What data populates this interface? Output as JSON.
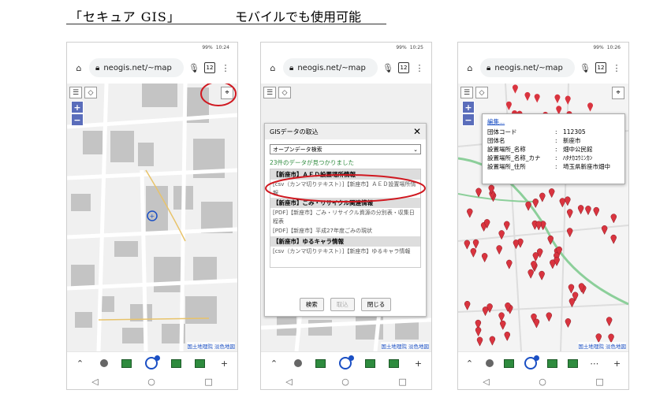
{
  "titles": {
    "left": "「セキュア GIS」",
    "right": "モバイルでも使用可能"
  },
  "phones": [
    {
      "time": "10:24",
      "battery": "99%",
      "url": "neogis.net/~map",
      "tab_count": "12"
    },
    {
      "time": "10:25",
      "battery": "99%",
      "url": "neogis.net/~map",
      "tab_count": "12"
    },
    {
      "time": "10:26",
      "battery": "99%",
      "url": "neogis.net/~map",
      "tab_count": "12"
    }
  ],
  "map": {
    "attribution": "国土地理院 淡色地図"
  },
  "dialog": {
    "title": "GISデータの取込",
    "close": "✕",
    "select_value": "オープンデータ検索",
    "found_text": "23件のデータが見つかりました",
    "items": [
      {
        "head": "【新座市】ＡＥＤ設置場所情報",
        "lines": [
          "[csv（カンマ切りテキスト）]【新座市】ＡＥＤ設置場所情報"
        ]
      },
      {
        "head": "【新座市】ごみ・リサイクル関連情報",
        "lines": [
          "[PDF]【新座市】ごみ・リサイクル資源の分別表・収集日程表",
          "[PDF]【新座市】平成27年度ごみの現状"
        ]
      },
      {
        "head": "【新座市】ゆるキャラ情報",
        "lines": [
          "[csv（カンマ切りテキスト）]【新座市】ゆるキャラ情報"
        ]
      }
    ],
    "buttons": {
      "search": "検索",
      "import": "取込",
      "close": "閉じる"
    }
  },
  "popup": {
    "edit": "編集...",
    "rows": [
      {
        "key": "団体コード",
        "value": "112305"
      },
      {
        "key": "団体名",
        "value": "新座市"
      },
      {
        "key": "設置場所_名称",
        "value": "畑中公民館"
      },
      {
        "key": "設置場所_名称_カナ",
        "value": "ﾊﾀﾅｶｺｳﾐﾝｶﾝ"
      },
      {
        "key": "設置場所_住所",
        "value": "埼玉県新座市畑中"
      }
    ]
  },
  "colors": {
    "pin": "#d9343f",
    "highlight": "#d01820",
    "zoom": "#5a6dbb",
    "green": "#2e8b3e"
  }
}
